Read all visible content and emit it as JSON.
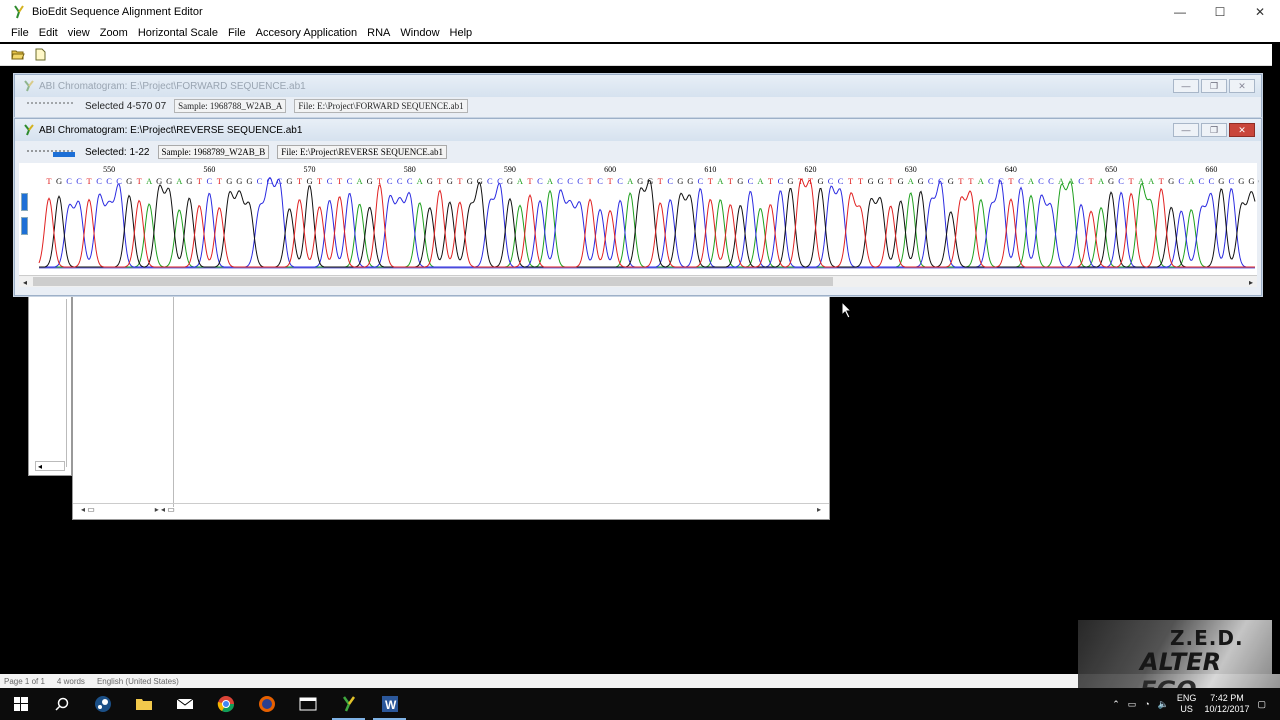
{
  "app": {
    "title": "BioEdit Sequence Alignment Editor",
    "controls": {
      "minimize": "—",
      "maximize": "☐",
      "close": "✕"
    }
  },
  "menu": [
    "File",
    "Edit",
    "view",
    "Zoom",
    "Horizontal Scale",
    "File",
    "Accesory Application",
    "RNA",
    "Window",
    "Help"
  ],
  "toolbar": {
    "open_icon": "folder-open-icon",
    "new_icon": "new-document-icon"
  },
  "chromatograms": [
    {
      "title": "ABI Chromatogram: E:\\Project\\FORWARD SEQUENCE.ab1",
      "selected": "Selected 4-570 07",
      "sample": "Sample: 1968788_W2AB_A",
      "file": "File: E:\\Project\\FORWARD SEQUENCE.ab1"
    },
    {
      "title": "ABI Chromatogram: E:\\Project\\REVERSE SEQUENCE.ab1",
      "selected": "Selected: 1-22",
      "sample": "Sample: 1968789_W2AB_B",
      "file": "File: E:\\Project\\REVERSE SEQUENCE.ab1",
      "ruler": [
        "550",
        "560",
        "570",
        "580",
        "590",
        "600",
        "610",
        "620",
        "630",
        "640",
        "650",
        "660"
      ],
      "sequence": "TGCCTCCCGTAGGAGTCTGGGCCCGTGTCTCAGTCCCAGTGTGGCCGATCACCCTCTCAGGTCGGCTATGCATCGTTGCCTTGGTGAGCCGTTACCTCACCAACTAGCTAATGCACCGCGGG"
    }
  ],
  "base_colors": {
    "A": "#1fa01f",
    "C": "#2b2be0",
    "G": "#111111",
    "T": "#e02222"
  },
  "statusbar": {
    "page": "Page 1 of 1",
    "words": "4 words",
    "language": "English (United States)"
  },
  "tray": {
    "lang1": "ENG",
    "lang2": "US",
    "time": "7:42 PM",
    "date": "10/12/2017"
  },
  "watermark": {
    "line1": "Z.E.D.",
    "line2": "ALTER EGO"
  }
}
